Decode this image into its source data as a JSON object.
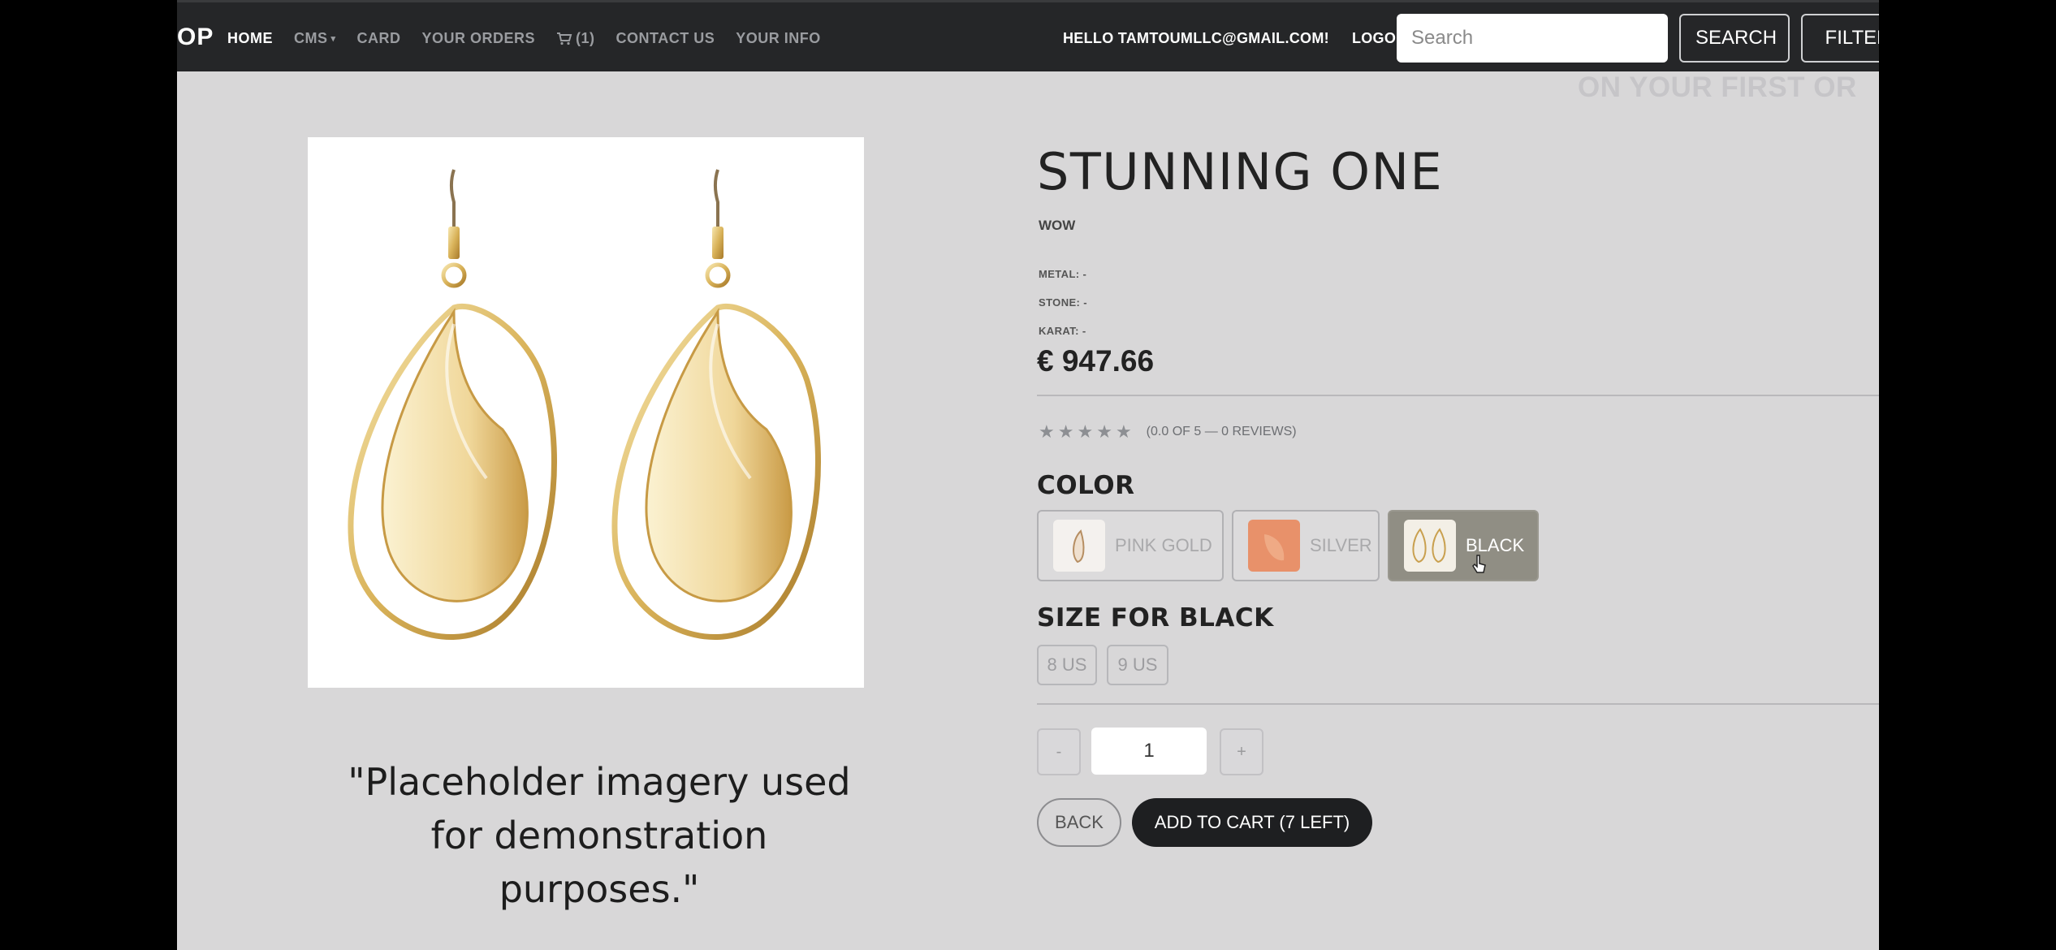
{
  "navbar": {
    "brand": "OP",
    "links": [
      {
        "label": "HOME",
        "active": true
      },
      {
        "label": "CMS",
        "dropdown": true
      },
      {
        "label": "CARD"
      },
      {
        "label": "YOUR ORDERS"
      },
      {
        "label": "(1)",
        "icon": "cart-icon"
      },
      {
        "label": "CONTACT US"
      },
      {
        "label": "YOUR INFO"
      }
    ],
    "greeting": "HELLO TAMTOUMLLC@GMAIL.COM!",
    "logout": "LOGOUT",
    "search_placeholder": "Search",
    "search_button": "SEARCH",
    "filter_button": "FILTER"
  },
  "promo_text": "ON YOUR FIRST OR",
  "product": {
    "title": "STUNNING ONE",
    "subtitle": "WOW",
    "specs": [
      "METAL: -",
      "STONE: -",
      "KARAT: -"
    ],
    "price": "€ 947.66",
    "rating_stars": 5,
    "rating_text": "(0.0 OF 5 — 0 REVIEWS)",
    "color_heading": "COLOR",
    "colors": [
      {
        "label": "PINK GOLD",
        "selected": false,
        "swatch": "#f4f1ee"
      },
      {
        "label": "SILVER",
        "selected": false,
        "swatch": "#e8916a"
      },
      {
        "label": "BLACK",
        "selected": true,
        "swatch": "#f3efe6"
      }
    ],
    "size_heading": "SIZE FOR BLACK",
    "sizes": [
      "8 US",
      "9 US"
    ],
    "qty_minus": "-",
    "qty_value": "1",
    "qty_plus": "+",
    "back_label": "BACK",
    "add_to_cart_label": "ADD TO CART (7 LEFT)"
  },
  "placeholder_note": "\"Placeholder imagery used for demonstration purposes.\"",
  "colors": {
    "navbar_bg": "#252628",
    "page_bg": "#d8d7d8",
    "primary_button": "#1e1f21",
    "selected_option": "#908e84",
    "gold": "#d9b35a"
  }
}
